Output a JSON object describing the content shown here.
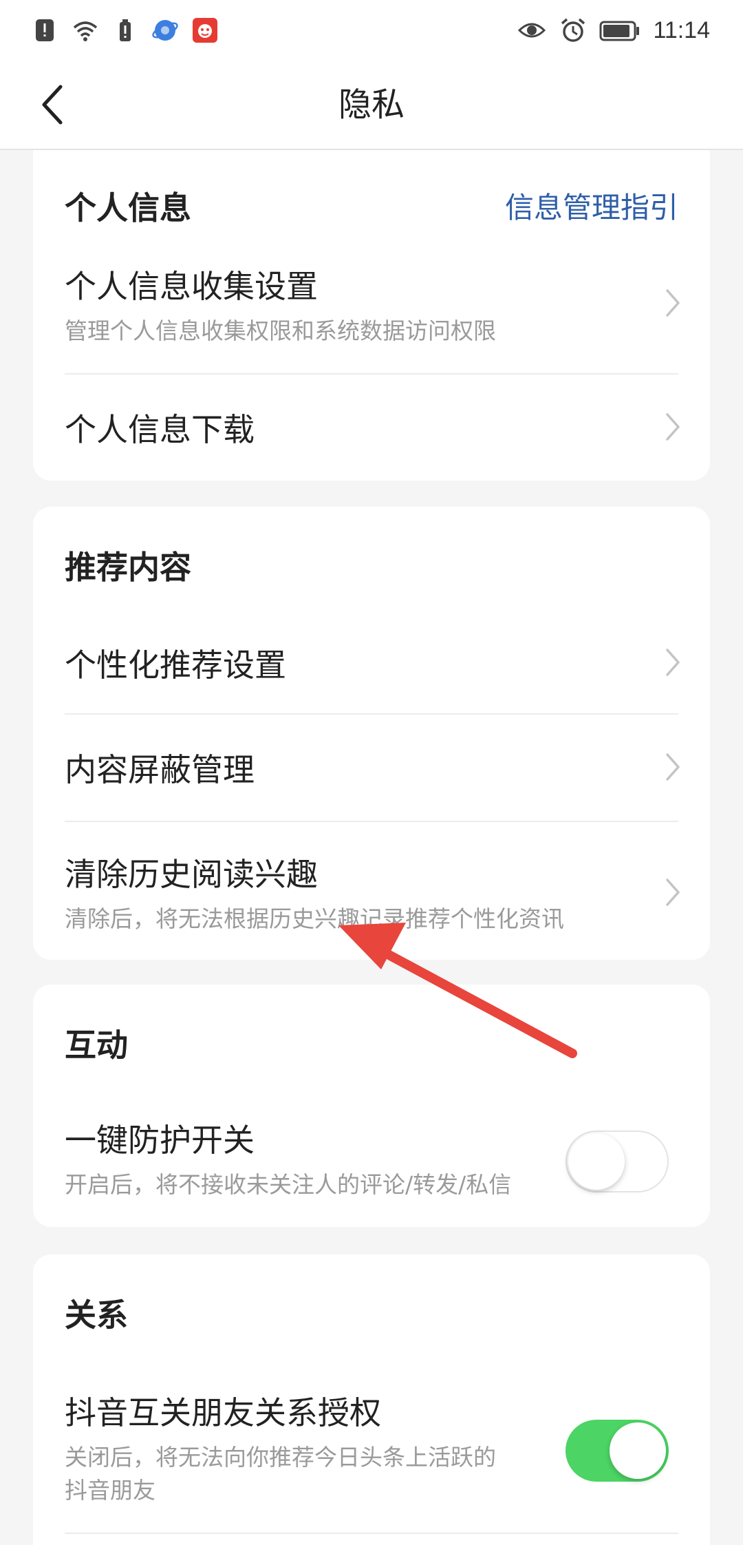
{
  "status_bar": {
    "time": "11:14",
    "left_icons": [
      "alert-icon",
      "wifi-icon",
      "battery-saver-icon",
      "browser-app-icon",
      "news-app-icon"
    ],
    "right_icons": [
      "eye-icon",
      "alarm-icon",
      "battery-icon"
    ]
  },
  "nav": {
    "title": "隐私"
  },
  "sections": {
    "personal_info": {
      "title": "个人信息",
      "link": "信息管理指引",
      "items": [
        {
          "title": "个人信息收集设置",
          "subtitle": "管理个人信息收集权限和系统数据访问权限"
        },
        {
          "title": "个人信息下载"
        }
      ]
    },
    "recommend": {
      "title": "推荐内容",
      "items": [
        {
          "title": "个性化推荐设置"
        },
        {
          "title": "内容屏蔽管理"
        },
        {
          "title": "清除历史阅读兴趣",
          "subtitle": "清除后，将无法根据历史兴趣记录推荐个性化资讯"
        }
      ]
    },
    "interaction": {
      "title": "互动",
      "items": [
        {
          "title": "一键防护开关",
          "subtitle": "开启后，将不接收未关注人的评论/转发/私信",
          "toggle": false
        }
      ]
    },
    "relation": {
      "title": "关系",
      "items": [
        {
          "title": "抖音互关朋友关系授权",
          "subtitle_line1": "关闭后，将无法向你推荐今日头条上活跃的",
          "subtitle_line2": "抖音朋友",
          "toggle": true
        }
      ]
    }
  },
  "colors": {
    "link": "#2f5ea8",
    "toggle_on": "#4cd464",
    "arrow": "#e8453c",
    "background": "#f5f5f5"
  }
}
